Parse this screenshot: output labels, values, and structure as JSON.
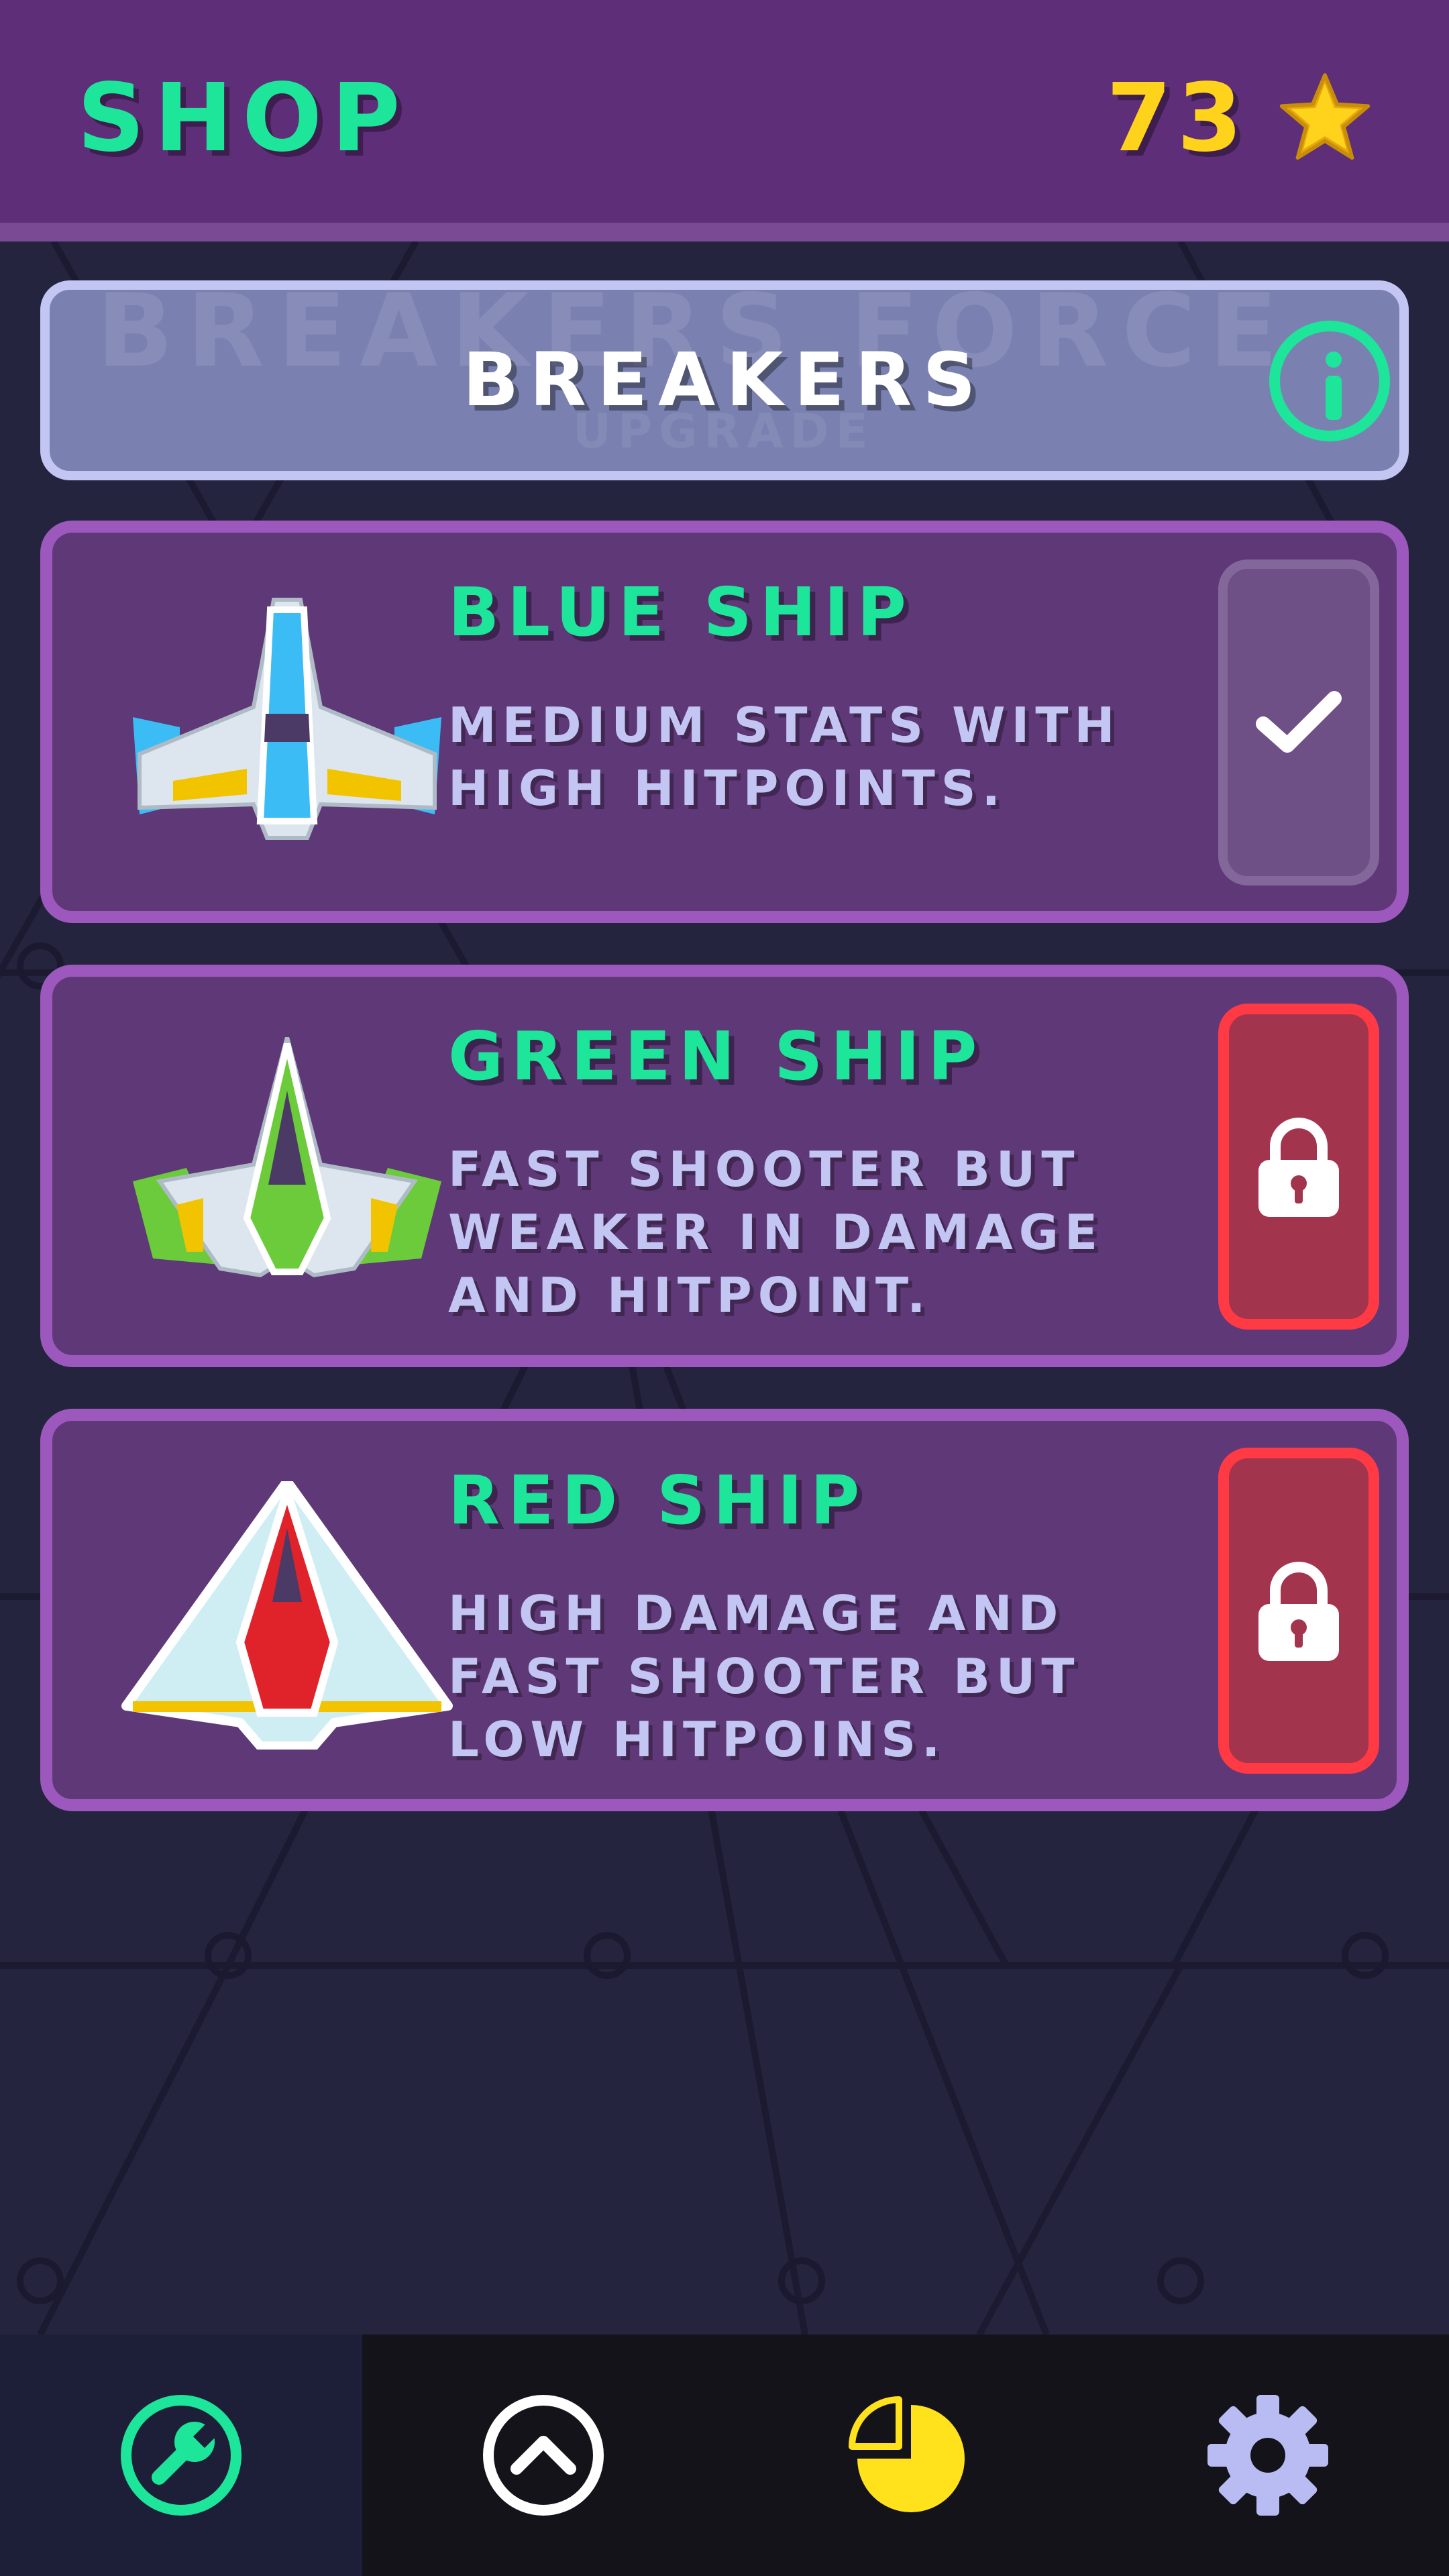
{
  "header": {
    "title": "SHOP",
    "star_count": "73"
  },
  "category": {
    "label": "BREAKERS",
    "ghost_text": "BREAKERS FORCE",
    "ghost_sub": "UPGRADE"
  },
  "ships": [
    {
      "name": "BLUE SHIP",
      "description": "MEDIUM STATS WITH HIGH HITPOINTS.",
      "status": "selected",
      "color": "#3bbcf5"
    },
    {
      "name": "GREEN SHIP",
      "description": "FAST SHOOTER BUT WEAKER IN DAMAGE AND HITPOINT.",
      "status": "locked",
      "color": "#6ccb3a"
    },
    {
      "name": "RED SHIP",
      "description": "HIGH DAMAGE AND FAST SHOOTER BUT LOW HITPOINS.",
      "status": "locked",
      "color": "#e0232a"
    }
  ],
  "nav": [
    {
      "icon": "wrench-icon",
      "active": true
    },
    {
      "icon": "chevron-up-icon",
      "active": false
    },
    {
      "icon": "pie-chart-icon",
      "active": false
    },
    {
      "icon": "gear-icon",
      "active": false
    }
  ],
  "colors": {
    "accent": "#1de59a",
    "star": "#ffd21c",
    "lock": "#ff3a44",
    "header": "#5e2f78",
    "card": "#5f3878"
  }
}
